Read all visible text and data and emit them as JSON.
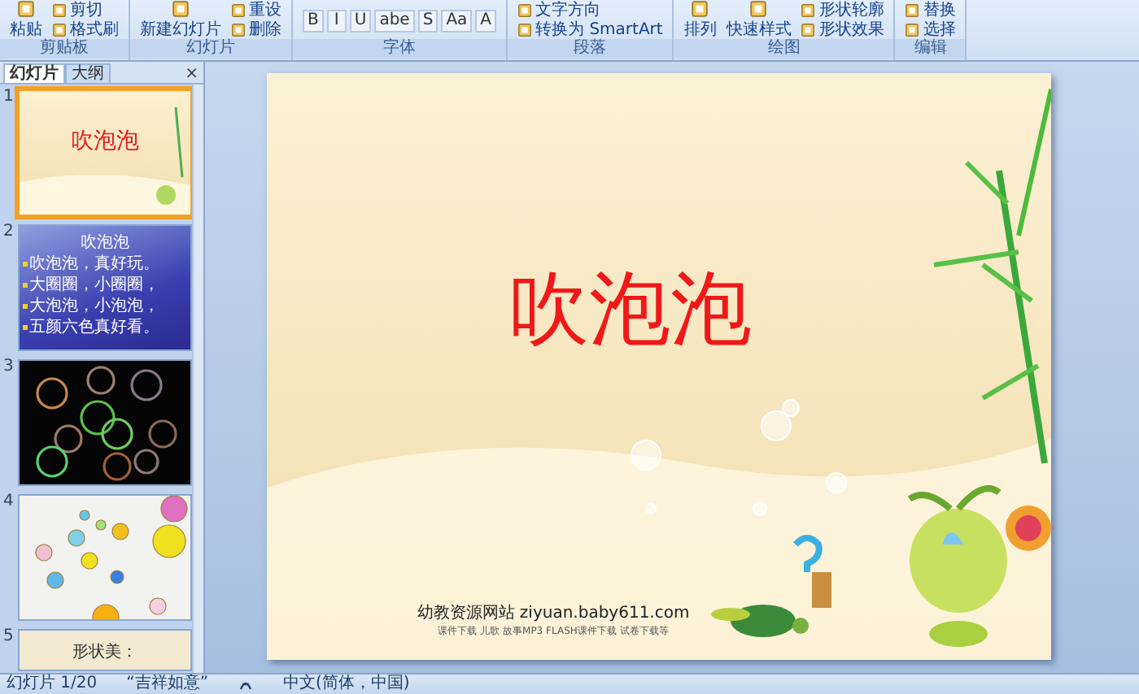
{
  "ribbon": {
    "groups": [
      {
        "label": "剪贴板",
        "items": [
          {
            "kind": "large",
            "label": "粘贴"
          },
          {
            "kind": "small",
            "label": "剪切"
          },
          {
            "kind": "small",
            "label": "格式刷"
          }
        ]
      },
      {
        "label": "幻灯片",
        "items": [
          {
            "kind": "large",
            "label": "新建幻灯片"
          },
          {
            "kind": "small",
            "label": "重设"
          },
          {
            "kind": "small",
            "label": "删除"
          }
        ]
      },
      {
        "label": "字体",
        "items": [
          {
            "kind": "glyph",
            "label": "B"
          },
          {
            "kind": "glyph",
            "label": "I"
          },
          {
            "kind": "glyph",
            "label": "U"
          },
          {
            "kind": "glyph",
            "label": "abe"
          },
          {
            "kind": "glyph",
            "label": "S"
          },
          {
            "kind": "glyph",
            "label": "Aa"
          },
          {
            "kind": "glyph",
            "label": "A"
          }
        ]
      },
      {
        "label": "段落",
        "items": [
          {
            "kind": "small",
            "label": "文字方向"
          },
          {
            "kind": "small",
            "label": "转换为 SmartArt"
          }
        ]
      },
      {
        "label": "绘图",
        "items": [
          {
            "kind": "large",
            "label": "排列"
          },
          {
            "kind": "large",
            "label": "快速样式"
          },
          {
            "kind": "small",
            "label": "形状轮廓"
          },
          {
            "kind": "small",
            "label": "形状效果"
          }
        ]
      },
      {
        "label": "编辑",
        "items": [
          {
            "kind": "small",
            "label": "替换"
          },
          {
            "kind": "small",
            "label": "选择"
          }
        ]
      }
    ]
  },
  "panel": {
    "tabs": [
      {
        "label": "幻灯片",
        "selected": true
      },
      {
        "label": "大纲",
        "selected": false
      }
    ],
    "close": "×",
    "slides": [
      {
        "number": "1",
        "kind": "title",
        "selected": true,
        "title": "吹泡泡"
      },
      {
        "number": "2",
        "kind": "text",
        "selected": false,
        "title": "吹泡泡",
        "lines": [
          "吹泡泡，真好玩。",
          "大圈圈，小圈圈，",
          "大泡泡，小泡泡，",
          "五颜六色真好看。"
        ]
      },
      {
        "number": "3",
        "kind": "dark-bubbles",
        "selected": false
      },
      {
        "number": "4",
        "kind": "light-bubbles",
        "selected": false
      },
      {
        "number": "5",
        "kind": "heading",
        "selected": false,
        "title": "形状美："
      }
    ]
  },
  "slide": {
    "title": "吹泡泡",
    "site": "幼教资源网站  ziyuan.baby611.com",
    "site_sub": "课件下载  儿歌  故事MP3  FLASH课件下载  试卷下载等"
  },
  "status_bar": {
    "slide": "幻灯片 1/20",
    "theme": "“吉祥如意”",
    "language": "中文(简体，中国)"
  }
}
